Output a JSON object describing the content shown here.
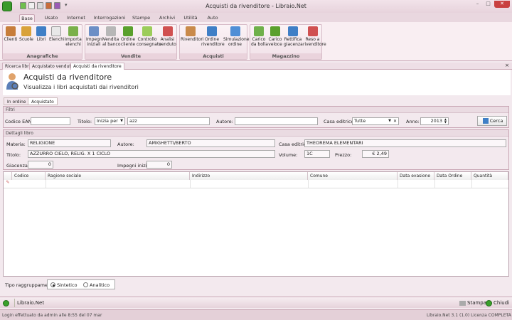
{
  "window": {
    "title": "Acquisti da rivenditore - Libraio.Net"
  },
  "menu_tabs": [
    "Base",
    "Usato",
    "Internet",
    "Interrogazioni",
    "Stampe",
    "Archivi",
    "Utilità",
    "Auto"
  ],
  "ribbon": {
    "anagrafiche": {
      "label": "Anagrafiche",
      "buttons": [
        "Clienti",
        "Scuole",
        "Libri",
        "Elenchi",
        "Importa\nelenchi"
      ]
    },
    "vendite": {
      "label": "Vendite",
      "buttons": [
        "Impegni\niniziali",
        "Vendita\nal banco",
        "Ordine\ncliente",
        "Controllo\nconsegnato",
        "Analisi\nvenduto"
      ]
    },
    "acquisti": {
      "label": "Acquisti",
      "buttons": [
        "Rivenditori",
        "Ordine\nrivenditore",
        "Simulazione\nordine"
      ]
    },
    "magazzino": {
      "label": "Magazzino",
      "buttons": [
        "Carico\nda bolla",
        "Carico\nveloce",
        "Rettifica\ngiacenza",
        "Reso a\nrivenditore"
      ]
    }
  },
  "doc_tabs": [
    "Ricerca libri",
    "Acquistato venduto",
    "Acquisti da rivenditore"
  ],
  "doc_close": "×",
  "header": {
    "title": "Acquisti da rivenditore",
    "subtitle": "Visualizza i libri acquistati dai rivenditori"
  },
  "sub_tabs": [
    "In ordine",
    "Acquistato"
  ],
  "filters": {
    "section": "Filtri",
    "ean_label": "Codice EAN:",
    "ean_value": "",
    "title_label": "Titolo:",
    "title_mode": "Inizia per",
    "title_value": "azz",
    "author_label": "Autore:",
    "author_value": "",
    "publisher_label": "Casa editrice:",
    "publisher_value": "Tutte",
    "year_label": "Anno:",
    "year_value": "2013",
    "search_button": "Cerca"
  },
  "details": {
    "section": "Dettagli libro",
    "materia_label": "Materia:",
    "materia": "RELIGIONE",
    "autore_label": "Autore:",
    "autore": "AMIGHETTI/BERTO",
    "editrice_label": "Casa editrice:",
    "editrice": "THEOREMA ELEMENTARI",
    "titolo_label": "Titolo:",
    "titolo": "AZZURRO CIELO, RELIG. X 1 CICLO",
    "volume_label": "Volume:",
    "volume": "1C",
    "prezzo_label": "Prezzo:",
    "prezzo": "€ 2,49",
    "giacenza_label": "Giacenza:",
    "giacenza": "0",
    "impegni_label": "Impegni iniziali:",
    "impegni": "0"
  },
  "grid": {
    "columns": [
      "Codice",
      "Ragione sociale",
      "Indirizzo",
      "Comune",
      "Data evasione",
      "Data Ordine",
      "Quantità"
    ]
  },
  "grouping": {
    "label": "Tipo raggruppamento:",
    "options": [
      "Sintetico",
      "Analitico"
    ],
    "selected": "Sintetico"
  },
  "footer": {
    "app": "Libraio.Net",
    "print_button": "Stampa",
    "close_button": "Chiudi"
  },
  "status": {
    "left": "Login effettuato da admin alle 8:55 del 07 mar",
    "right": "Libraio.Net 3.1 (1.0) Licenza COMPLETA"
  },
  "colors": {
    "accent": "#3a9a2b",
    "ribbon_bg": "#f9eef2",
    "panel_bg": "#f3e9ee"
  }
}
